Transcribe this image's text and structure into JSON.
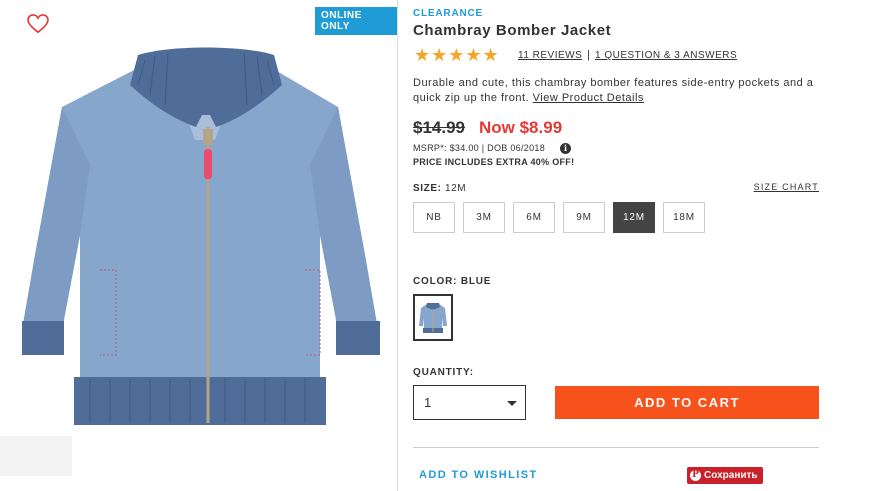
{
  "product_image": {
    "badge": "ONLINE ONLY",
    "favorite_icon": "heart-outline-icon"
  },
  "product": {
    "tag": "CLEARANCE",
    "title": "Chambray Bomber Jacket",
    "rating": 5,
    "stars": "★★★★★",
    "reviews_link": "11 REVIEWS",
    "qa_separator": "|",
    "qa_link": "1 QUESTION & 3 ANSWERS",
    "description": "Durable and cute, this chambray bomber features side-entry pockets and a quick zip up the front.",
    "details_link": "View Product Details"
  },
  "pricing": {
    "original": "$14.99",
    "now": "Now $8.99",
    "msrp": "MSRP*: $34.00 | DOB 06/2018",
    "info_icon": "i",
    "extra": "PRICE INCLUDES EXTRA 40% OFF!"
  },
  "size": {
    "label": "SIZE:",
    "selected_value": "12M",
    "chart_link": "SIZE CHART",
    "options": [
      "NB",
      "3M",
      "6M",
      "9M",
      "12M",
      "18M"
    ],
    "selected_index": 4
  },
  "color": {
    "label": "COLOR: BLUE"
  },
  "quantity": {
    "label": "QUANTITY:",
    "value": "1"
  },
  "actions": {
    "add_to_cart": "ADD TO CART",
    "add_to_wishlist": "ADD TO WISHLIST",
    "pin_icon": "P",
    "pin_label": "Сохранить"
  },
  "colors": {
    "accent_blue": "#1f9bd6",
    "sale_red": "#e53935",
    "cart_orange": "#f7521c",
    "star_gold": "#f5a623",
    "pinterest_red": "#cb2027"
  }
}
